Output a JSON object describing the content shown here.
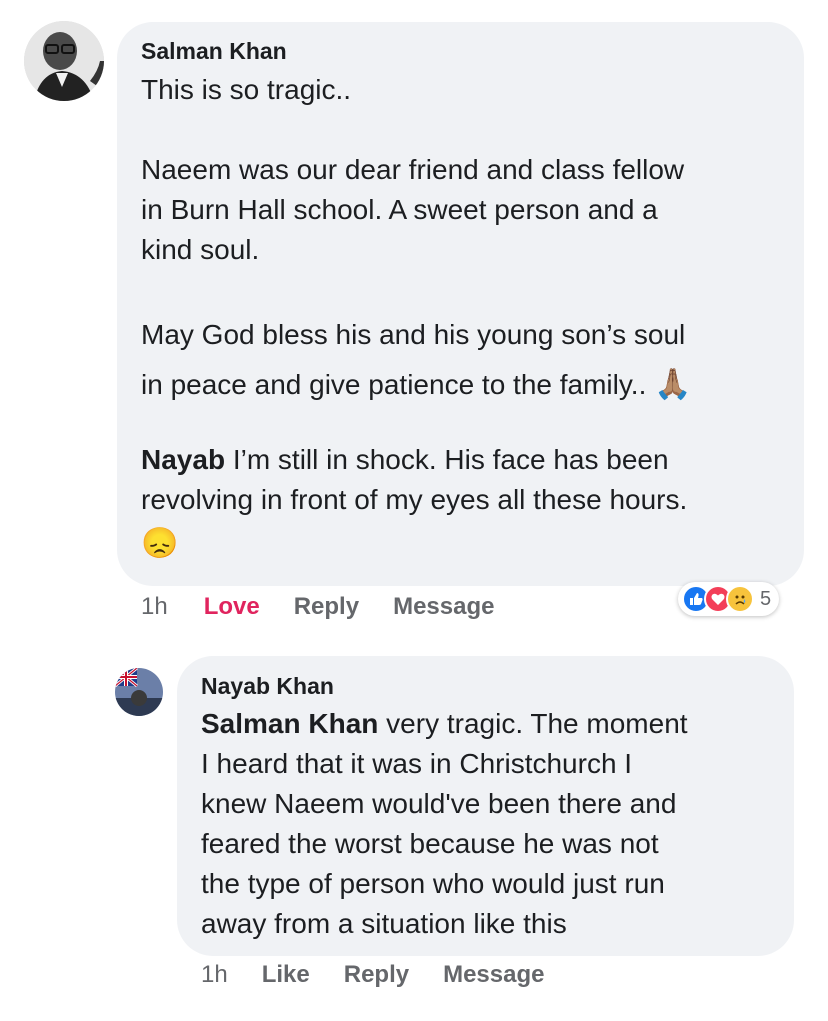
{
  "comment": {
    "author": "Salman Khan",
    "paragraphs": [
      [
        "This is so tragic.."
      ],
      [
        "Naeem was our dear friend and class fellow",
        "in Burn Hall school. A sweet person and a",
        "kind soul."
      ],
      [
        "May God bless his and his young son’s soul",
        "in peace and give patience to the family.. "
      ]
    ],
    "mention_name": "Nayab",
    "mention_lines": [
      " I’m still in shock.  His face has been",
      "revolving in front of my eyes all these hours."
    ],
    "pray_emoji": "🙏🏽",
    "sad_emoji": "😞",
    "timestamp": "1h",
    "love_label": "Love",
    "reply_label": "Reply",
    "message_label": "Message",
    "reaction_count": "5",
    "reactions": [
      "like-icon",
      "love-icon",
      "sad-icon"
    ],
    "love_color": "#e0245e"
  },
  "reply": {
    "author": "Nayab Khan",
    "mention_name": "Salman Khan",
    "lines": [
      " very tragic.  The moment",
      "I heard that it was in Christchurch I",
      "knew Naeem would've been there and",
      "feared the worst because he was not",
      "the type of person who would just run",
      "away from a situation like this"
    ],
    "timestamp": "1h",
    "like_label": "Like",
    "reply_label": "Reply",
    "message_label": "Message"
  }
}
